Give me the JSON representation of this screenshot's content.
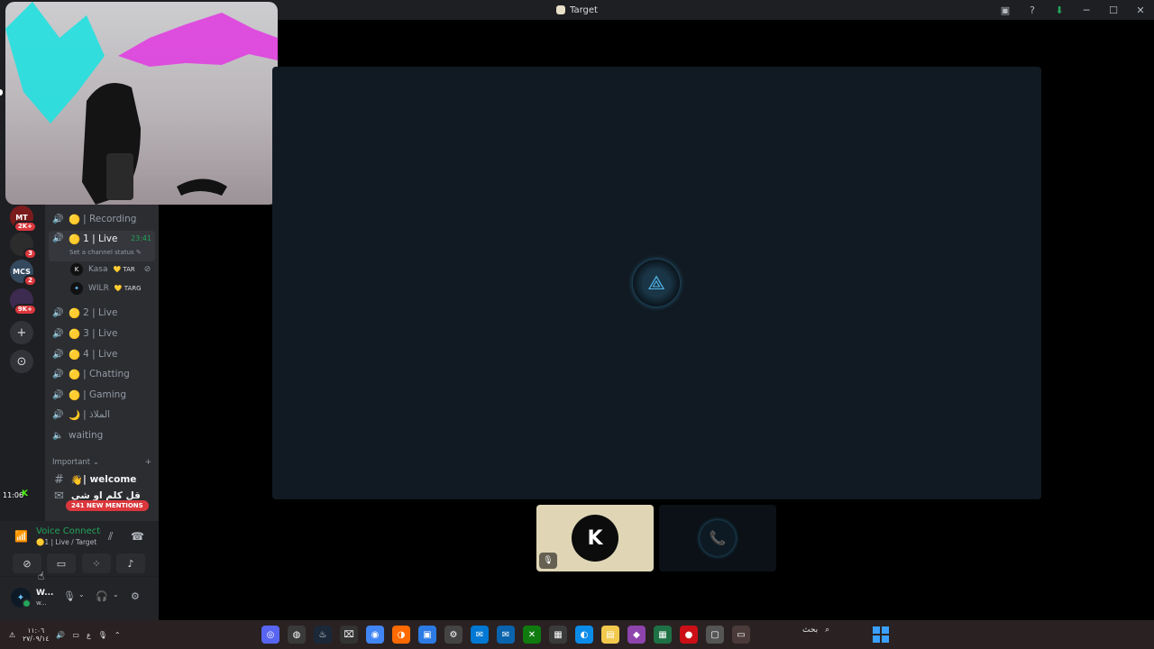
{
  "window": {
    "title": "Target",
    "controls": {
      "screen": "▣",
      "help": "?",
      "download": "⬇",
      "minimize": "─",
      "maximize": "☐",
      "close": "✕"
    }
  },
  "servers": [
    {
      "label": "MT",
      "badge": "2K+",
      "color": "#7a1b1b"
    },
    {
      "label": "",
      "badge": "3",
      "color": "#2c2c2c"
    },
    {
      "label": "MCS",
      "badge": "2",
      "color": "#34495e"
    },
    {
      "label": "",
      "badge": "9K+",
      "color": "#3d2a4f"
    }
  ],
  "rail_buttons": {
    "add": "+",
    "discover": "⊙"
  },
  "voice_channels": [
    {
      "emoji": "🟡",
      "name": "| Recording"
    },
    {
      "emoji": "🟡",
      "name": "1 | Live",
      "time": "23:41",
      "status": "Set a channel status ✎",
      "active": true
    },
    {
      "emoji": "🟡",
      "name": "2 | Live"
    },
    {
      "emoji": "🟡",
      "name": "3 | Live"
    },
    {
      "emoji": "🟡",
      "name": "4 | Live"
    },
    {
      "emoji": "🟡",
      "name": "| Chatting"
    },
    {
      "emoji": "🟡",
      "name": "| Gaming"
    },
    {
      "emoji": "🌙",
      "name": "| الملاذ"
    },
    {
      "emoji": "",
      "name": "waiting"
    }
  ],
  "voice_users": [
    {
      "name": "Kasa",
      "tag": "💛 TAR",
      "avatar": "K"
    },
    {
      "name": "WILR",
      "tag": "💛 TARG",
      "avatar": "✦"
    }
  ],
  "category": {
    "name": "Important ⌄",
    "add": "+"
  },
  "text_channels": [
    {
      "emoji": "👋",
      "name": "| welcome"
    },
    {
      "emoji": "",
      "name": "قل كلم او شي"
    }
  ],
  "mentions_badge": "241 NEW MENTIONS",
  "overlay": {
    "clock": "11:06",
    "stream_label": "K"
  },
  "voice_panel": {
    "status": "Voice Connected",
    "sub": "🟡1 | Live / Target"
  },
  "user": {
    "name": "W...",
    "sub": "w..."
  },
  "stage": {
    "logo": "⟁"
  },
  "tiles": [
    {
      "initial": "K",
      "mute": "🎙"
    },
    {
      "icon": "📞"
    }
  ],
  "taskbar": {
    "time": "١١:٠٦",
    "date": "٢٧/٠٩/١٤",
    "lang": "ع",
    "search": "بحث",
    "apps": [
      "◎",
      "◍",
      "♨",
      "⌧",
      "◉",
      "◑",
      "▣",
      "⚙",
      "✉",
      "✉",
      "✕",
      "▦",
      "◐",
      "▤",
      "◆",
      "▦",
      "●",
      "▢",
      "▭"
    ]
  }
}
